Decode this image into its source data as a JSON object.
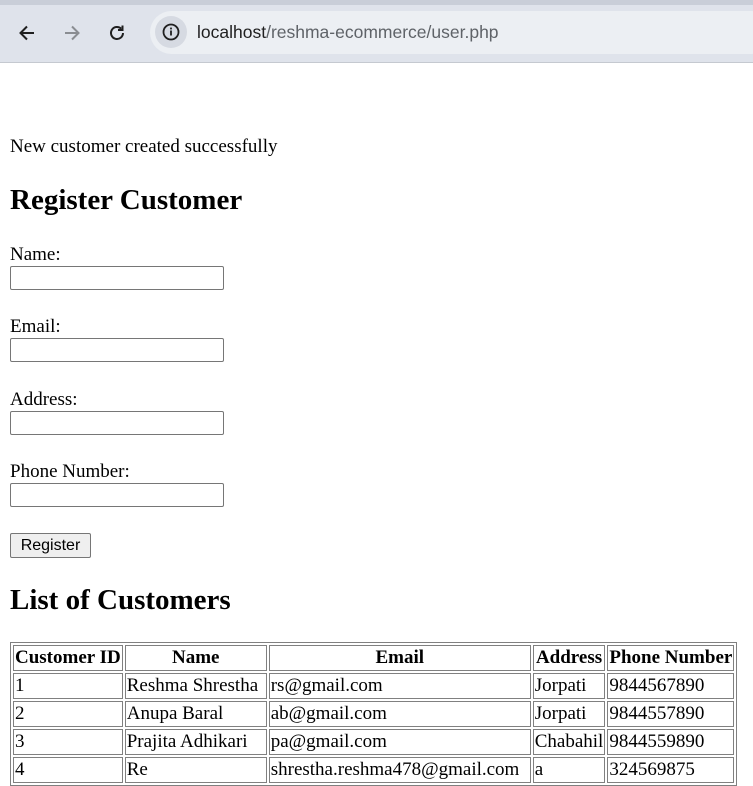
{
  "browser": {
    "url_host": "localhost",
    "url_path": "/reshma-ecommerce/user.php"
  },
  "status_message": "New customer created successfully",
  "form": {
    "heading": "Register Customer",
    "fields": [
      {
        "label": "Name:",
        "value": ""
      },
      {
        "label": "Email:",
        "value": ""
      },
      {
        "label": "Address:",
        "value": ""
      },
      {
        "label": "Phone Number:",
        "value": ""
      }
    ],
    "submit_label": "Register"
  },
  "customers": {
    "heading": "List of Customers",
    "columns": [
      "Customer ID",
      "Name",
      "Email",
      "Address",
      "Phone Number"
    ],
    "rows": [
      [
        "1",
        "Reshma Shrestha",
        "rs@gmail.com",
        "Jorpati",
        "9844567890"
      ],
      [
        "2",
        "Anupa Baral",
        "ab@gmail.com",
        "Jorpati",
        "9844557890"
      ],
      [
        "3",
        "Prajita Adhikari",
        "pa@gmail.com",
        "Chabahil",
        "9844559890"
      ],
      [
        "4",
        "Re",
        "shrestha.reshma478@gmail.com",
        "a",
        "324569875"
      ]
    ]
  }
}
